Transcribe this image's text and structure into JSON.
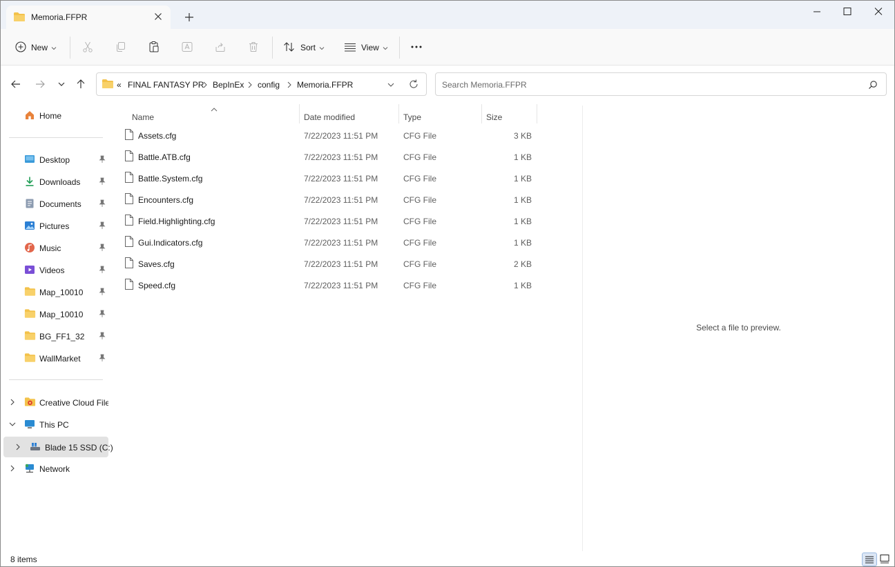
{
  "tab": {
    "title": "Memoria.FFPR"
  },
  "toolbar": {
    "new_label": "New",
    "sort_label": "Sort",
    "view_label": "View"
  },
  "address": {
    "overflow": "«",
    "crumbs": [
      "FINAL FANTASY PR",
      "BepInEx",
      "config",
      "Memoria.FFPR"
    ]
  },
  "search": {
    "placeholder": "Search Memoria.FFPR"
  },
  "sidebar": {
    "home": "Home",
    "quick_access": [
      {
        "label": "Desktop",
        "icon": "desktop-icon"
      },
      {
        "label": "Downloads",
        "icon": "downloads-icon"
      },
      {
        "label": "Documents",
        "icon": "documents-icon"
      },
      {
        "label": "Pictures",
        "icon": "pictures-icon"
      },
      {
        "label": "Music",
        "icon": "music-icon"
      },
      {
        "label": "Videos",
        "icon": "videos-icon"
      },
      {
        "label": "Map_10010",
        "icon": "folder-icon"
      },
      {
        "label": "Map_10010",
        "icon": "folder-icon"
      },
      {
        "label": "BG_FF1_32",
        "icon": "folder-icon"
      },
      {
        "label": "WallMarket",
        "icon": "folder-icon"
      }
    ],
    "creative_cloud": "Creative Cloud Files",
    "this_pc": "This PC",
    "drive": "Blade 15 SSD (C:)",
    "network": "Network"
  },
  "columns": {
    "name": "Name",
    "date": "Date modified",
    "type": "Type",
    "size": "Size"
  },
  "files": [
    {
      "name": "Assets.cfg",
      "date": "7/22/2023 11:51 PM",
      "type": "CFG File",
      "size": "3 KB"
    },
    {
      "name": "Battle.ATB.cfg",
      "date": "7/22/2023 11:51 PM",
      "type": "CFG File",
      "size": "1 KB"
    },
    {
      "name": "Battle.System.cfg",
      "date": "7/22/2023 11:51 PM",
      "type": "CFG File",
      "size": "1 KB"
    },
    {
      "name": "Encounters.cfg",
      "date": "7/22/2023 11:51 PM",
      "type": "CFG File",
      "size": "1 KB"
    },
    {
      "name": "Field.Highlighting.cfg",
      "date": "7/22/2023 11:51 PM",
      "type": "CFG File",
      "size": "1 KB"
    },
    {
      "name": "Gui.Indicators.cfg",
      "date": "7/22/2023 11:51 PM",
      "type": "CFG File",
      "size": "1 KB"
    },
    {
      "name": "Saves.cfg",
      "date": "7/22/2023 11:51 PM",
      "type": "CFG File",
      "size": "2 KB"
    },
    {
      "name": "Speed.cfg",
      "date": "7/22/2023 11:51 PM",
      "type": "CFG File",
      "size": "1 KB"
    }
  ],
  "preview": {
    "message": "Select a file to preview."
  },
  "status": {
    "count": "8 items"
  },
  "colors": {
    "folder": "#f3c24b",
    "accent": "#0f6cbd",
    "selected": "#e2e2e2"
  }
}
